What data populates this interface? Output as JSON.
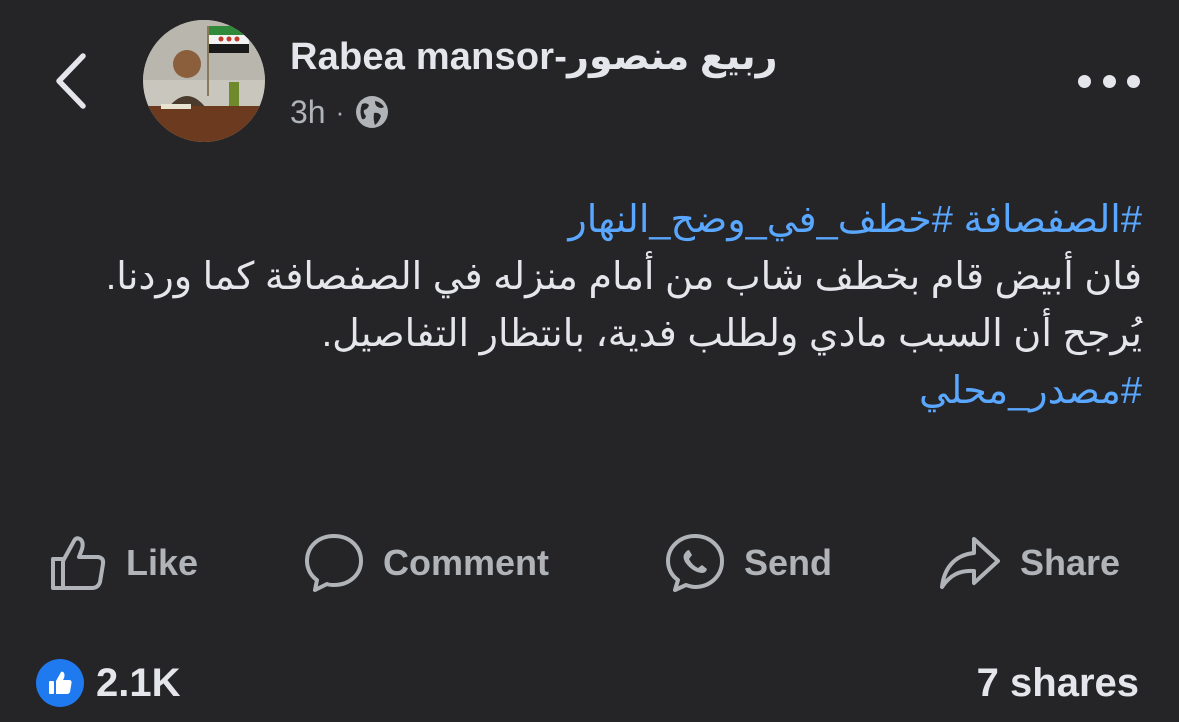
{
  "header": {
    "author_name": "Rabea mansor-ربيع منصور",
    "timestamp": "3h",
    "separator": "·",
    "audience_icon": "globe-icon",
    "back_icon": "chevron-left-icon",
    "more_icon": "more-horizontal-icon"
  },
  "post": {
    "hashtags_line": [
      "#الصفصافة",
      "#خطف_في_وضح_النهار"
    ],
    "paragraph_1": "فان أبيض قام بخطف شاب من أمام منزله في الصفصافة كما وردنا.",
    "paragraph_2": "يُرجح أن السبب مادي ولطلب فدية، بانتظار التفاصيل.",
    "source_hashtag": "#مصدر_محلي"
  },
  "actions": {
    "like": {
      "label": "Like",
      "icon": "thumbs-up-icon"
    },
    "comment": {
      "label": "Comment",
      "icon": "comment-bubble-icon"
    },
    "send": {
      "label": "Send",
      "icon": "messenger-icon"
    },
    "share": {
      "label": "Share",
      "icon": "share-arrow-icon"
    }
  },
  "stats": {
    "reactions": "2.1K",
    "reaction_icon": "like-reaction-icon",
    "shares": "7 shares"
  },
  "colors": {
    "background": "#252527",
    "text": "#e4e6eb",
    "muted": "#b0b3b8",
    "hashtag": "#5aa7ff",
    "like_badge": "#1f7af0"
  }
}
